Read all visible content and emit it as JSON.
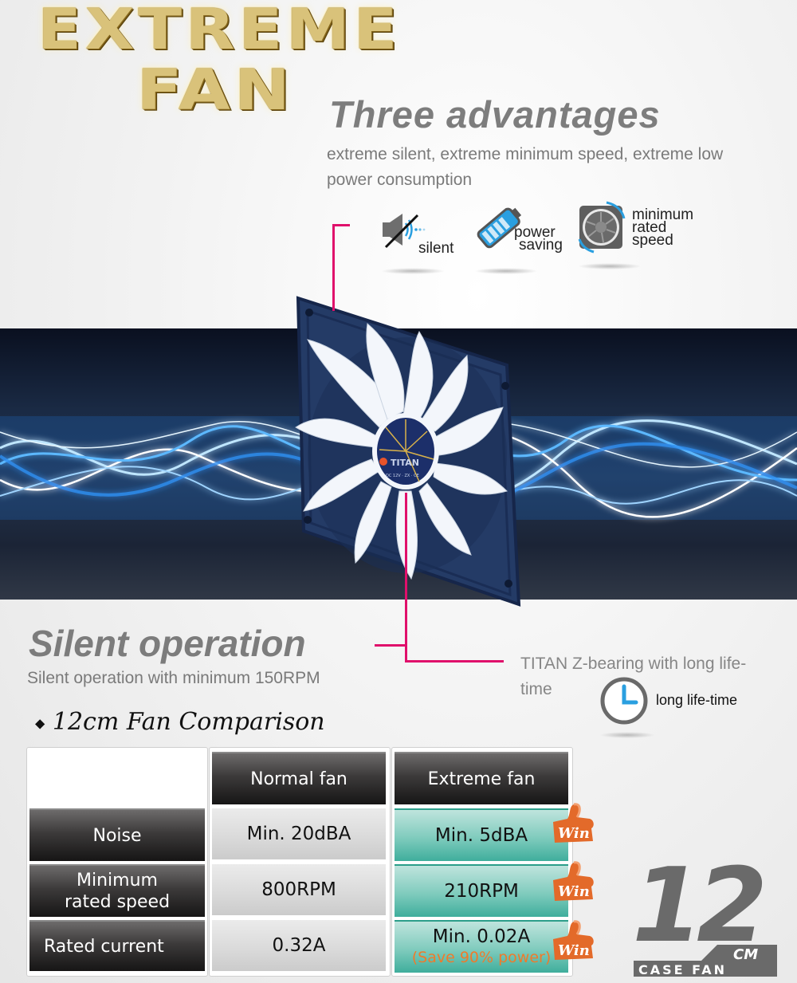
{
  "logo": {
    "line1": "EXTREME",
    "line2": "FAN"
  },
  "advantages": {
    "title": "Three advantages",
    "subtitle": "extreme silent, extreme minimum speed, extreme low power consumption",
    "icons": [
      {
        "icon": "muted-speaker-icon",
        "label": "silent"
      },
      {
        "icon": "battery-icon",
        "label_line1": "power",
        "label_line2": "saving"
      },
      {
        "icon": "fan-icon",
        "label_line1": "minimum",
        "label_line2": "rated",
        "label_line3": "speed"
      }
    ]
  },
  "fan_hub": {
    "brand": "TITAN",
    "marking": "DC 12V · ZX · CE"
  },
  "silent": {
    "title": "Silent operation",
    "subtitle": "Silent operation with minimum 150RPM"
  },
  "bearing": {
    "text": "TITAN Z-bearing with long life-time",
    "icon": "clock-icon",
    "icon_label": "long life-time"
  },
  "comparison": {
    "title": "12cm Fan Comparison",
    "bullet": "◆",
    "columns": [
      "Normal fan",
      "Extreme fan"
    ],
    "rows": [
      {
        "label": "Noise",
        "normal": "Min. 20dBA",
        "extreme": "Min. 5dBA",
        "note": "",
        "badge": "Win"
      },
      {
        "label": "Minimum rated speed",
        "label_line1": "Minimum",
        "label_line2": "rated speed",
        "normal": "800RPM",
        "extreme": "210RPM",
        "note": "",
        "badge": "Win"
      },
      {
        "label": "Rated current",
        "normal": "0.32A",
        "extreme": "Min. 0.02A",
        "note": "(Save 90% power)",
        "badge": "Win"
      }
    ]
  },
  "size_badge": {
    "number": "12",
    "unit": "CM",
    "caption": "CASE FAN"
  },
  "colors": {
    "accent_pink": "#e0106b",
    "teal": "#4fb5a3",
    "win_orange": "#e8682a",
    "icon_blue": "#2a9fe0",
    "heading_grey": "#7d7d7d"
  }
}
